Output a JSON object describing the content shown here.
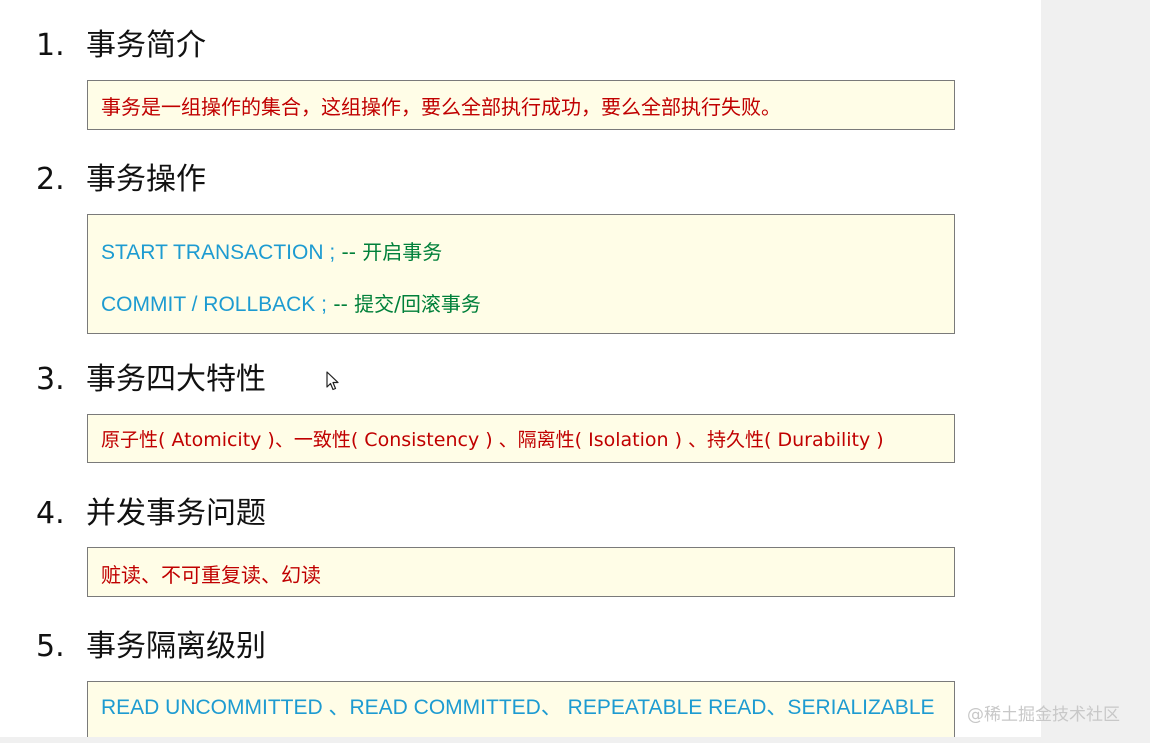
{
  "sections": [
    {
      "number": "1.",
      "title": "事务简介",
      "lines": [
        {
          "text": "事务是一组操作的集合，这组操作，要么全部执行成功，要么全部执行失败。"
        }
      ]
    },
    {
      "number": "2.",
      "title": "事务操作",
      "lines": [
        {
          "code": "START  TRANSACTION ;",
          "comment": " -- 开启事务"
        },
        {
          "code": "COMMIT / ROLLBACK ;",
          "comment": "  -- 提交/回滚事务"
        }
      ]
    },
    {
      "number": "3.",
      "title": "事务四大特性",
      "lines": [
        {
          "text": "原子性( Atomicity )、一致性( Consistency ) 、隔离性( Isolation ) 、持久性( Durability )"
        }
      ]
    },
    {
      "number": "4.",
      "title": "并发事务问题",
      "lines": [
        {
          "text": "赃读、不可重复读、幻读"
        }
      ]
    },
    {
      "number": "5.",
      "title": "事务隔离级别",
      "lines": [
        {
          "text": "READ UNCOMMITTED 、READ COMMITTED、 REPEATABLE READ、SERIALIZABLE"
        }
      ]
    }
  ],
  "watermark": "@稀土掘金技术社区",
  "colors": {
    "box_background": "#fffde7",
    "red_text": "#c00000",
    "blue_code": "#1d9bd1",
    "green_comment": "#00803a"
  }
}
